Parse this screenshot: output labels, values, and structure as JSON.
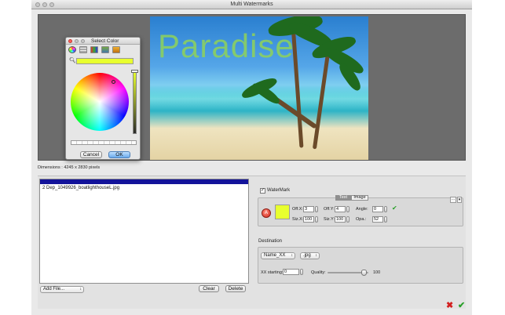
{
  "window": {
    "title": "Multi Watermarks"
  },
  "preview": {
    "watermark_text": "Paradise",
    "dimensions": "Dimensions : 4245 x 2830 pixels"
  },
  "color_dialog": {
    "title": "Select Color",
    "search_icon": "magnifier-icon",
    "selected_color": "#e8ff2e",
    "cancel_label": "Cancel",
    "ok_label": "OK"
  },
  "files": {
    "items": [
      "2 Dep_1049926_boatlighthouseL.jpg"
    ],
    "add_label": "Add File...",
    "clear_label": "Clear",
    "delete_label": "Delete"
  },
  "watermark": {
    "checkbox_label": "WaterMark",
    "checked": true,
    "tabs": [
      "Text",
      "Image"
    ],
    "active_tab": "Text",
    "color": "#e8ff2e",
    "off_x_label": "Off.X:",
    "off_x": "3",
    "off_y_label": "Off.Y:",
    "off_y": "4",
    "siz_x_label": "Siz.X:",
    "siz_x": "100",
    "siz_y_label": "Siz.Y:",
    "siz_y": "100",
    "angle_label": "Angle:",
    "angle": "0",
    "opa_label": "Opa.:",
    "opa": "52"
  },
  "destination": {
    "title": "Destination",
    "name_select": "Name_XX",
    "format_select": ".jpg",
    "xx_starting_label": "XX starting:",
    "xx_starting": "0",
    "quality_label": "Quality:",
    "quality": "100",
    "quality_fraction": 0.9
  }
}
